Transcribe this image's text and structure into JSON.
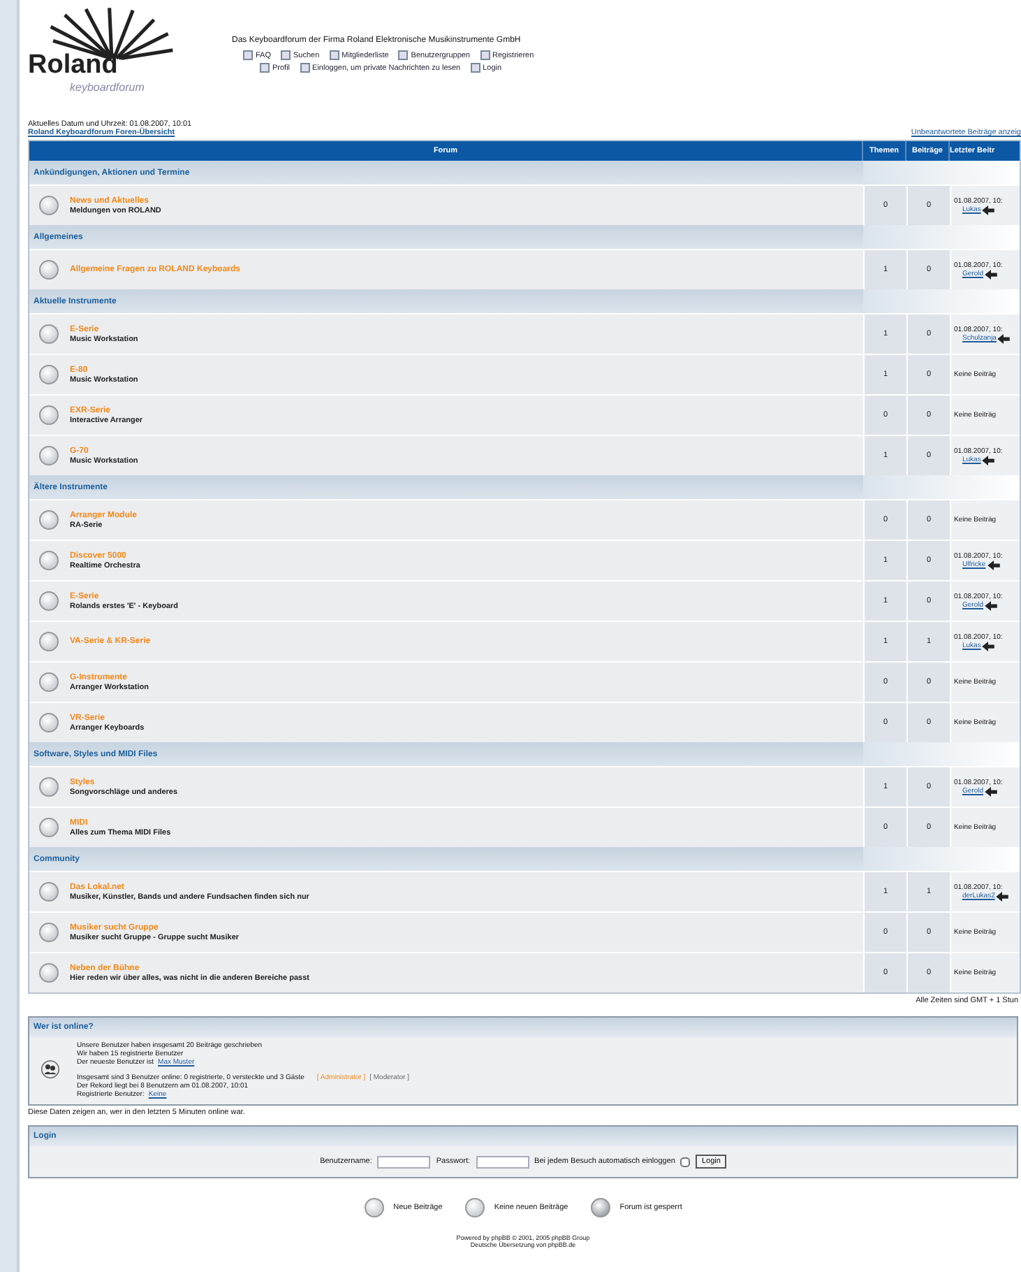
{
  "header": {
    "logo_word": "Roland",
    "logo_sub": "keyboardforum",
    "tagline": "Das Keyboardforum der Firma Roland Elektronische Musikinstrumente GmbH",
    "nav_rows": [
      [
        "FAQ",
        "Suchen",
        "Mitgliederliste",
        "Benutzergruppen",
        "Registrieren"
      ],
      [
        "Profil",
        "Einloggen, um private Nachrichten zu lesen",
        "Login"
      ]
    ]
  },
  "date_line": "Aktuelles Datum und Uhrzeit: 01.08.2007, 10:01",
  "breadcrumb": "Roland Keyboardforum Foren-Übersicht",
  "unanswered_link": "Unbeantwortete Beiträge anzeig",
  "table": {
    "columns": [
      "Forum",
      "Themen",
      "Beiträge",
      "Letzter Beitr"
    ],
    "categories": [
      {
        "title": "Ankündigungen, Aktionen und Termine",
        "forums": [
          {
            "title": "News und Aktuelles",
            "description": "Meldungen von ROLAND",
            "topics": "0",
            "posts": "0",
            "last_post": {
              "kind": "post",
              "date": "01.08.2007, 10:",
              "user": "Lukas"
            }
          }
        ]
      },
      {
        "title": "Allgemeines",
        "forums": [
          {
            "title": "Allgemeine Fragen zu ROLAND Keyboards",
            "topics": "1",
            "posts": "0",
            "last_post": {
              "kind": "post",
              "date": "01.08.2007, 10:",
              "user": "Gerold"
            }
          }
        ]
      },
      {
        "title": "Aktuelle Instrumente",
        "forums": [
          {
            "title": "E-Serie",
            "description": "Music Workstation",
            "topics": "1",
            "posts": "0",
            "last_post": {
              "kind": "post",
              "date": "01.08.2007, 10:",
              "user": "Schulzanja"
            }
          },
          {
            "title": "E-80",
            "description": "Music Workstation",
            "topics": "1",
            "posts": "0",
            "last_post": {
              "kind": "none",
              "text": "Keine Beiträg"
            }
          },
          {
            "title": "EXR-Serie",
            "description": "Interactive Arranger",
            "topics": "0",
            "posts": "0",
            "last_post": {
              "kind": "none",
              "text": "Keine Beiträg"
            }
          },
          {
            "title": "G-70",
            "description": "Music Workstation",
            "topics": "1",
            "posts": "0",
            "last_post": {
              "kind": "post",
              "date": "01.08.2007, 10:",
              "user": "Lukas"
            }
          }
        ]
      },
      {
        "title": "Ältere Instrumente",
        "forums": [
          {
            "title": "Arranger Module",
            "description": "RA-Serie",
            "topics": "0",
            "posts": "0",
            "last_post": {
              "kind": "none",
              "text": "Keine Beiträg"
            }
          },
          {
            "title": "Discover 5000",
            "description": "Realtime Orchestra",
            "topics": "1",
            "posts": "0",
            "last_post": {
              "kind": "post",
              "date": "01.08.2007, 10:",
              "user": "Ulfricke"
            }
          },
          {
            "title": "E-Serie",
            "description": "Rolands erstes 'E' - Keyboard",
            "topics": "1",
            "posts": "0",
            "last_post": {
              "kind": "post",
              "date": "01.08.2007, 10:",
              "user": "Gerold"
            }
          },
          {
            "title": "VA-Serie & KR-Serie",
            "topics": "1",
            "posts": "1",
            "last_post": {
              "kind": "post",
              "date": "01.08.2007, 10:",
              "user": "Lukas"
            }
          },
          {
            "title": "G-Instrumente",
            "description": "Arranger Workstation",
            "topics": "0",
            "posts": "0",
            "last_post": {
              "kind": "none",
              "text": "Keine Beiträg"
            }
          },
          {
            "title": "VR-Serie",
            "description": "Arranger Keyboards",
            "topics": "0",
            "posts": "0",
            "last_post": {
              "kind": "none",
              "text": "Keine Beiträg"
            }
          }
        ]
      },
      {
        "title": "Software, Styles und MIDI Files",
        "forums": [
          {
            "title": "Styles",
            "description": "Songvorschläge und anderes",
            "topics": "1",
            "posts": "0",
            "last_post": {
              "kind": "post",
              "date": "01.08.2007, 10:",
              "user": "Gerold"
            }
          },
          {
            "title": "MIDI",
            "description": "Alles zum Thema MIDI Files",
            "topics": "0",
            "posts": "0",
            "last_post": {
              "kind": "none",
              "text": "Keine Beiträg"
            }
          }
        ]
      },
      {
        "title": "Community",
        "forums": [
          {
            "title": "Das Lokal.net",
            "description": "Musiker, Künstler, Bands und andere Fundsachen finden sich nur",
            "topics": "1",
            "posts": "1",
            "last_post": {
              "kind": "post",
              "date": "01.08.2007, 10:",
              "user": "derLukas2"
            }
          },
          {
            "title": "Musiker sucht Gruppe",
            "description": "Musiker sucht Gruppe - Gruppe sucht Musiker",
            "topics": "0",
            "posts": "0",
            "last_post": {
              "kind": "none",
              "text": "Keine Beiträg"
            }
          },
          {
            "title": "Neben der Bühne",
            "description": "Hier reden wir über alles, was nicht in die anderen Bereiche passt",
            "topics": "0",
            "posts": "0",
            "last_post": {
              "kind": "none",
              "text": "Keine Beiträg"
            }
          }
        ]
      }
    ]
  },
  "timezone": "Alle Zeiten sind GMT + 1 Stun",
  "online": {
    "title": "Wer ist online?",
    "lines_a": [
      "Unsere Benutzer haben insgesamt 20 Beiträge geschrieben",
      "Wir haben 15 registrierte Benutzer"
    ],
    "newest_prefix": "Der neueste Benutzer ist",
    "newest_user": "Max Muster",
    "online_line": "Insgesamt sind 3 Benutzer online: 0 registrierte, 0 versteckte und 3 Gäste",
    "legend": [
      "[ Administrator ]",
      "[ Moderator ]"
    ],
    "record_line": "Der Rekord liegt bei 8 Benutzern am 01.08.2007, 10:01",
    "registered_prefix": "Registrierte Benutzer:",
    "registered_user": "Keine",
    "note": "Diese Daten zeigen an, wer in den letzten 5 Minuten online war."
  },
  "login": {
    "title": "Login",
    "username_label": "Benutzername:",
    "password_label": "Passwort:",
    "auto_label": "Bei jedem Besuch automatisch einloggen",
    "auto_checked": false,
    "button": "Login"
  },
  "legend": [
    "Neue Beiträge",
    "Keine neuen Beiträge",
    "Forum ist gesperrt"
  ],
  "footer": [
    "Powered by phpBB © 2001, 2005 phpBB Group",
    "Deutsche Übersetzung von phpBB.de"
  ]
}
